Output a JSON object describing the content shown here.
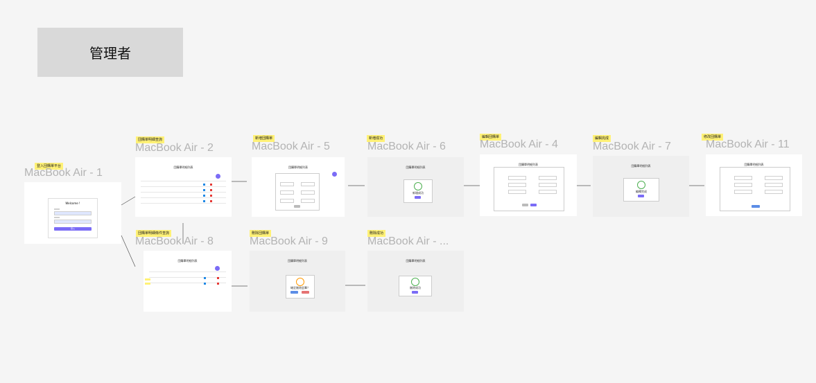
{
  "heading": "管理者",
  "frames": [
    {
      "label": "MacBook Air - 1",
      "note": "登入団購單平台"
    },
    {
      "label": "MacBook Air - 2",
      "note": "団購單明細查詢"
    },
    {
      "label": "MacBook Air - 5",
      "note": "新増団購單"
    },
    {
      "label": "MacBook Air - 6",
      "note": "新増成功"
    },
    {
      "label": "MacBook Air - 4",
      "note": "編輯団購單"
    },
    {
      "label": "MacBook Air - 7",
      "note": "編輯完成"
    },
    {
      "label": "MacBook Air - 11",
      "note": "修改団購單"
    },
    {
      "label": "MacBook Air - 8",
      "note": "団購單明細條件查詢"
    },
    {
      "label": "MacBook Air - 9",
      "note": "刪除団購單"
    },
    {
      "label": "MacBook Air - ...",
      "note": "刪除成功"
    }
  ],
  "login": {
    "title": "Welcome !",
    "button": "登入"
  },
  "screen_title": "団購單明細列表",
  "modals": {
    "add_success": "新増成功",
    "edit_success": "編輯完成",
    "delete_confirm": "確定刪除此筆？",
    "delete_success": "刪除成功",
    "confirm_button": "確定",
    "cancel_button": "取消"
  },
  "colors": {
    "accent": "#7b6cf6",
    "danger": "#e53935",
    "note": "#fff176",
    "success": "#4caf50"
  }
}
